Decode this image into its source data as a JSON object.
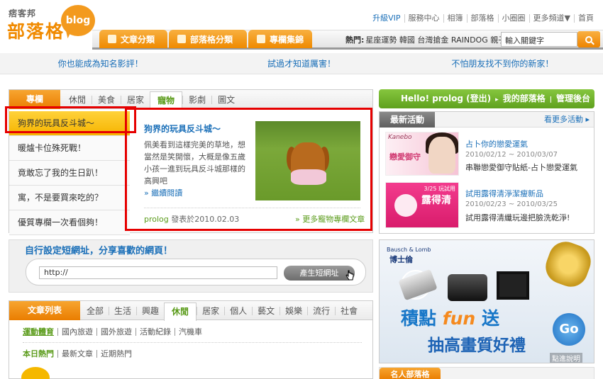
{
  "brand": {
    "small": "痞客邦",
    "main": "部落格",
    "bubble": "blog"
  },
  "toplinks": [
    "升級VIP",
    "服務中心",
    "相簿",
    "部落格",
    "小圈圈",
    "更多頻道▼",
    "首頁"
  ],
  "nav": {
    "tabs": [
      "文章分類",
      "部落格分類",
      "專欄集錦"
    ],
    "hot_label": "熱門:",
    "hot_items": "星座運勢 韓國 台灣搶金 RAINDOG 親子",
    "search_value": "輸入關鍵字"
  },
  "promo": [
    "你也能成為知名影評！",
    "試過才知道厲害！",
    "不怕朋友找不到你的新家！"
  ],
  "featured": {
    "main_tab": "專欄",
    "categories": [
      "休閒",
      "美食",
      "居家",
      "寵物",
      "影劇",
      "圖文"
    ],
    "active_category": "寵物",
    "sidelist": [
      "狗界的玩具反斗城～",
      "暖爐卡位殊死戰！",
      "竟敢忘了我的生日趴！",
      "寓，不是要買來吃的？",
      "優質專欄一次看個夠！"
    ],
    "article": {
      "title": "狗界的玩具反斗城～",
      "body": "佩美看到這樣完美的草地，想當然是笑開懷，大概是像五歲小孩一進到玩具反斗城那樣的高興吧",
      "read_more": "» 繼續閱讀",
      "author": "prolog",
      "posted": "發表於2010.02.03",
      "more_link": "» 更多寵物專欄文章"
    }
  },
  "shorturl": {
    "title": "自行設定短網址，分享喜歡的網頁！",
    "input_value": "http://",
    "button": "產生短網址"
  },
  "articles": {
    "main_tab": "文章列表",
    "categories": [
      "全部",
      "生活",
      "興趣",
      "休閒",
      "居家",
      "個人",
      "藝文",
      "娛樂",
      "流行",
      "社會"
    ],
    "active_category": "休閒",
    "sub": [
      "運動體育",
      "國內旅遊",
      "國外旅遊",
      "活動紀錄",
      "汽機車"
    ],
    "sub2": [
      "本日熱門",
      "最新文章",
      "近期熱門"
    ]
  },
  "greenbar": {
    "hello": "Hello! prolog (登出)",
    "my_blog": "我的部落格",
    "admin": "管理後台"
  },
  "events": {
    "tab": "最新活動",
    "more": "看更多活動",
    "items": [
      {
        "title": "占卜你的戀愛運氣",
        "date": "2010/02/12 ~ 2010/03/07",
        "desc": "串聯戀愛御守貼紙-占卜戀愛運氣",
        "img_brand": "Kanebo",
        "img_text": "戀愛御守"
      },
      {
        "title": "試用露得清淨潔瘦新品",
        "date": "2010/02/23 ~ 2010/03/25",
        "desc": "試用露得清纖玩邊把臉洗乾淨!",
        "img_date": "3/25 玩試用",
        "img_name": "露得清"
      }
    ]
  },
  "ad": {
    "logo_en": "Bausch & Lomb",
    "logo_zh": "博士倫",
    "headline_a": "積點",
    "headline_fun": "fun",
    "headline_b": "送",
    "sub": "抽高畫質好禮",
    "go": "Go",
    "note": "點進說明"
  },
  "famous": {
    "tab": "名人部落格"
  }
}
